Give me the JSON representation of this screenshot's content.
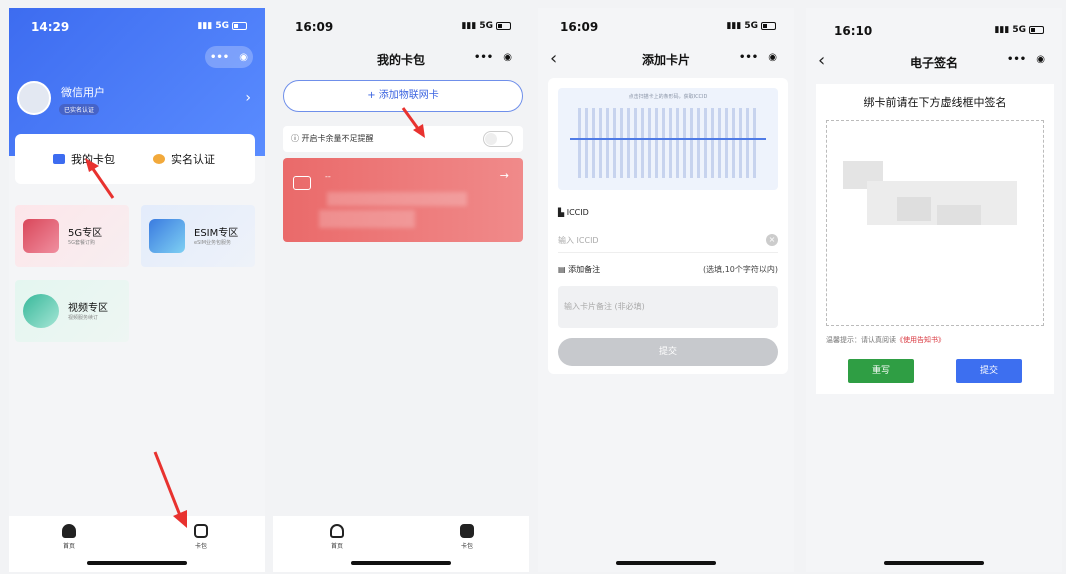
{
  "panel1": {
    "time": "14:29",
    "signal": "5G",
    "user_name": "微信用户",
    "verified_badge": "已实名认证",
    "menu": [
      {
        "label": "我的卡包",
        "icon": "wallet-icon"
      },
      {
        "label": "实名认证",
        "icon": "person-verify-icon"
      }
    ],
    "zones": [
      {
        "title": "5G专区",
        "subtitle": "5G套餐订购"
      },
      {
        "title": "ESIM专区",
        "subtitle": "eSIM业务包服务"
      },
      {
        "title": "视频专区",
        "subtitle": "视频服务续订"
      }
    ],
    "tabs": [
      "首页",
      "卡包"
    ]
  },
  "panel2": {
    "time": "16:09",
    "signal": "5G",
    "title": "我的卡包",
    "add_button": "+ 添加物联网卡",
    "reminder": "开启卡余量不足提醒",
    "card_number": "--",
    "tabs": [
      "首页",
      "卡包"
    ]
  },
  "panel3": {
    "time": "16:09",
    "signal": "5G",
    "title": "添加卡片",
    "scan_hint": "点击扫描卡上的条形码，获取ICCID",
    "iccid_label": "ICCID",
    "iccid_placeholder": "输入 ICCID",
    "remark_label": "添加备注",
    "remark_hint": "(选填,10个字符以内)",
    "remark_placeholder": "输入卡片备注 (非必填)",
    "submit": "提交"
  },
  "panel4": {
    "time": "16:10",
    "signal": "5G",
    "title": "电子签名",
    "instruction": "绑卡前请在下方虚线框中签名",
    "tip_prefix": "温馨提示：请认真阅读",
    "tip_link": "《使用告知书》",
    "rewrite": "重写",
    "submit": "提交"
  },
  "colors": {
    "primary": "#3d6cf0",
    "card_red": "#ea6a6a",
    "rewrite_green": "#2f9e44",
    "submit_blue": "#3d6ff0",
    "arrow_red": "#e8322f"
  }
}
